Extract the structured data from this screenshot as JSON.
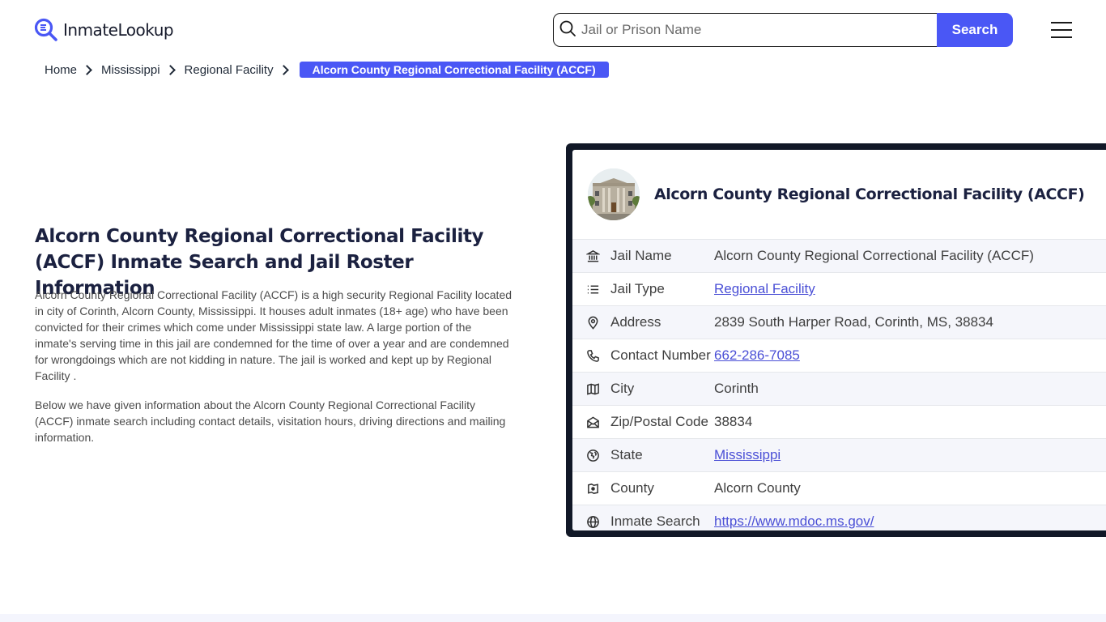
{
  "header": {
    "logo_text": "InmateLookup",
    "search": {
      "placeholder": "Jail or Prison Name",
      "value": "",
      "button_label": "Search"
    },
    "menu_icon": "hamburger-menu-icon"
  },
  "breadcrumb": [
    {
      "label": "Home"
    },
    {
      "label": "Mississippi"
    },
    {
      "label": "Regional Facility"
    },
    {
      "label": "Alcorn County Regional Correctional Facility (ACCF)",
      "active": true
    }
  ],
  "main": {
    "title": "Alcorn County Regional Correctional Facility (ACCF) Inmate Search and Jail Roster Information",
    "paragraphs": [
      "Alcorn County Regional Correctional Facility (ACCF) is a high security Regional Facility located in city of Corinth, Alcorn County, Mississippi. It houses adult inmates (18+ age) who have been convicted for their crimes which come under Mississippi state law. A large portion of the inmate's serving time in this jail are condemned for the time of over a year and are condemned for wrongdoings which are not kidding in nature. The jail is worked and kept up by Regional Facility .",
      "Below we have given information about the Alcorn County Regional Correctional Facility (ACCF) inmate search including contact details, visitation hours, driving directions and mailing information."
    ]
  },
  "card": {
    "title": "Alcorn County Regional Correctional Facility (ACCF)",
    "rows": [
      {
        "icon": "building-columns-icon",
        "label": "Jail Name",
        "value": "Alcorn County Regional Correctional Facility (ACCF)",
        "link": false
      },
      {
        "icon": "list-icon",
        "label": "Jail Type",
        "value": "Regional Facility",
        "link": true
      },
      {
        "icon": "map-pin-icon",
        "label": "Address",
        "value": "2839 South Harper Road, Corinth, MS, 38834",
        "link": false
      },
      {
        "icon": "phone-icon",
        "label": "Contact Number",
        "value": "662-286-7085",
        "link": true
      },
      {
        "icon": "map-icon",
        "label": "City",
        "value": "Corinth",
        "link": false
      },
      {
        "icon": "mail-open-icon",
        "label": "Zip/Postal Code",
        "value": "38834",
        "link": false
      },
      {
        "icon": "state-globe-icon",
        "label": "State",
        "value": "Mississippi",
        "link": true
      },
      {
        "icon": "county-map-icon",
        "label": "County",
        "value": "Alcorn County",
        "link": false
      },
      {
        "icon": "world-icon",
        "label": "Inmate Search",
        "value": "https://www.mdoc.ms.gov/",
        "link": true
      }
    ]
  },
  "colors": {
    "accent": "#4a57f5",
    "card_border": "#111827",
    "link": "#4a4fd6",
    "title": "#1b2140"
  }
}
